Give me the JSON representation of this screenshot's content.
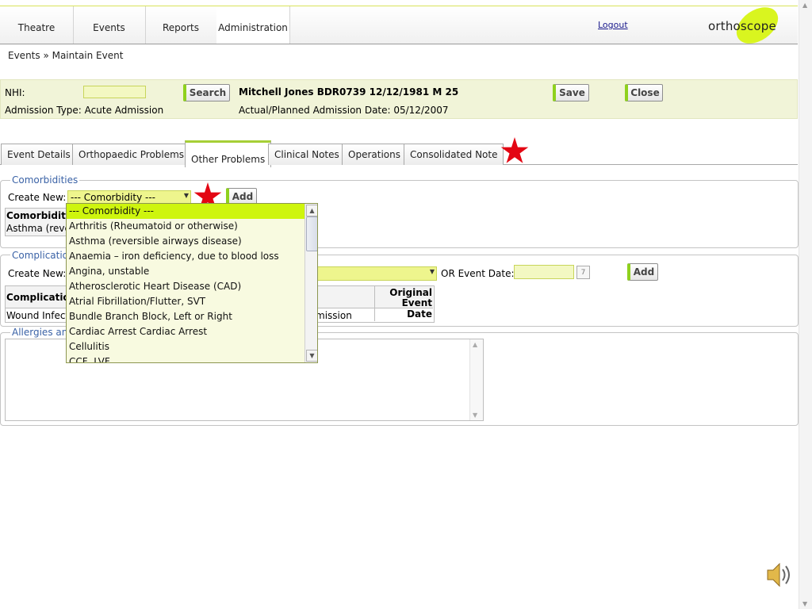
{
  "nav": {
    "tabs": [
      "Theatre",
      "Events",
      "Reports",
      "Administration"
    ],
    "logout": "Logout",
    "logo": "orthoscope"
  },
  "breadcrumb": "Events » Maintain Event",
  "patient": {
    "nhi_label": "NHI:",
    "nhi_value": "",
    "search": "Search",
    "name_line": "Mitchell Jones BDR0739 12/12/1981 M 25",
    "admission_type": "Admission Type: Acute Admission",
    "admission_date": "Actual/Planned Admission Date: 05/12/2007",
    "save": "Save",
    "close": "Close"
  },
  "tabs": [
    "Event Details",
    "Orthopaedic Problems",
    "Other Problems",
    "Clinical Notes",
    "Operations",
    "Consolidated Note"
  ],
  "active_tab": "Other Problems",
  "comorbidities": {
    "legend": "Comorbidities",
    "create_new": "Create New:",
    "select_value": "--- Comorbidity ---",
    "add": "Add",
    "col_header": "Comorbidity",
    "row_partial": "Asthma (reve"
  },
  "complications": {
    "legend": "Complication",
    "create_new": "Create New:",
    "or_event_date": "OR Event Date:",
    "date_value": "",
    "add": "Add",
    "col_header": "Complicatio",
    "original_header_1": "Original",
    "original_header_2": "Event Date",
    "row_partial": "Wound Infect",
    "row_tail": "mission"
  },
  "allergies": {
    "legend": "Allergies an"
  },
  "dropdown": {
    "options": [
      "--- Comorbidity ---",
      "Arthritis (Rheumatoid or otherwise)",
      "Asthma (reversible airways disease)",
      "Anaemia – iron deficiency, due to blood loss",
      "Angina, unstable",
      "Atherosclerotic Heart Disease (CAD)",
      "Atrial Fibrillation/Flutter, SVT",
      "Bundle Branch Block, Left or Right",
      "Cardiac Arrest Cardiac Arrest",
      "Cellulitis",
      "CCF, LVF"
    ],
    "selected_index": 0
  },
  "colors": {
    "accent_green": "#8fd11e",
    "highlight": "#cef50e",
    "legend_blue": "#3a62a6",
    "star_red": "#e30613"
  },
  "icons": {
    "calendar": "calendar-icon",
    "speaker": "speaker-icon",
    "star": "star-marker"
  }
}
